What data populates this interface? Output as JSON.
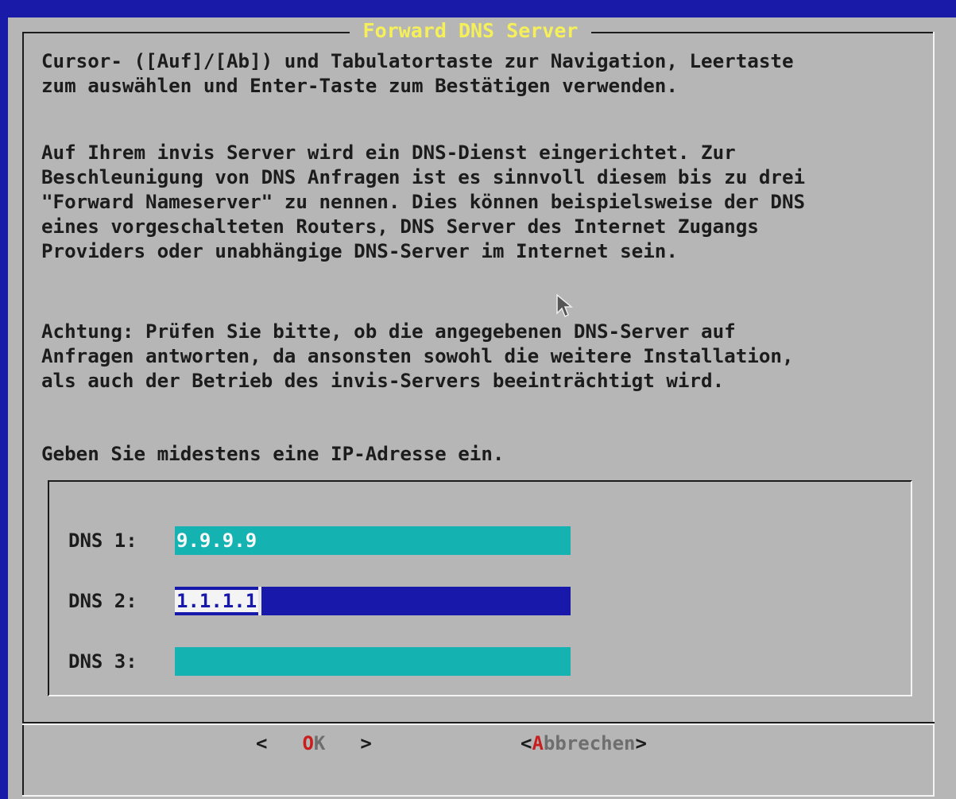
{
  "dialog": {
    "title": "Forward DNS Server",
    "instructions": "Cursor- ([Auf]/[Ab]) und Tabulatortaste zur Navigation, Leertaste\nzum auswählen und Enter-Taste zum Bestätigen verwenden.",
    "description": "Auf Ihrem invis Server wird ein DNS-Dienst eingerichtet. Zur\nBeschleunigung von DNS Anfragen ist es sinnvoll diesem bis zu drei\n\"Forward Nameserver\" zu nennen. Dies können beispielsweise der DNS\neines vorgeschalteten Routers, DNS Server des Internet Zugangs\nProviders oder unabhängige DNS-Server im Internet sein.",
    "warning": "Achtung: Prüfen Sie bitte, ob die angegebenen DNS-Server auf\nAnfragen antworten, da ansonsten sowohl die weitere Installation,\nals auch der Betrieb des invis-Servers beeinträchtigt wird.",
    "prompt": "Geben Sie midestens eine IP-Adresse ein."
  },
  "fields": [
    {
      "label": "DNS 1:",
      "value": "9.9.9.9"
    },
    {
      "label": "DNS 2:",
      "value": "1.1.1.1"
    },
    {
      "label": "DNS 3:",
      "value": ""
    }
  ],
  "buttons": {
    "ok": {
      "left": "<",
      "hotkey": "O",
      "rest": "K",
      "right": ">"
    },
    "cancel": {
      "left": "<",
      "hotkey": "A",
      "rest": "bbrechen",
      "right": ">"
    }
  },
  "colors": {
    "screen_bg": "#1a1aa8",
    "dialog_bg": "#b6b6b6",
    "title": "#f5f05a",
    "field_bg": "#15b2b2",
    "field_active_bg": "#1818aa",
    "hotkey": "#c81e1e"
  }
}
